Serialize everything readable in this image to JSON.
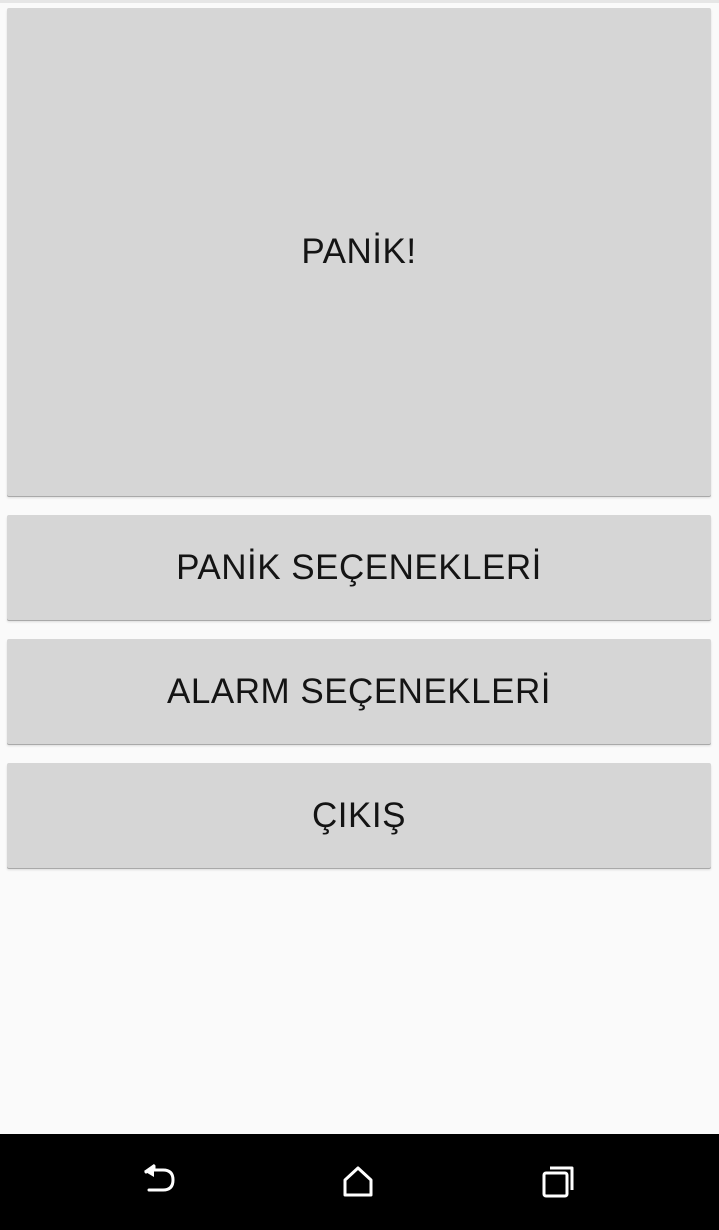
{
  "buttons": {
    "panic_label": "PANİK!",
    "panic_options_label": "PANİK SEÇENEKLERİ",
    "alarm_options_label": "ALARM SEÇENEKLERİ",
    "exit_label": "ÇIKIŞ"
  },
  "navigation_bar": {
    "icons": [
      "back-icon",
      "home-icon",
      "recents-icon"
    ]
  },
  "colors": {
    "button_background": "#d6d6d6",
    "screen_background": "#fafafa",
    "navbar_background": "#000000",
    "button_text": "#141414"
  }
}
